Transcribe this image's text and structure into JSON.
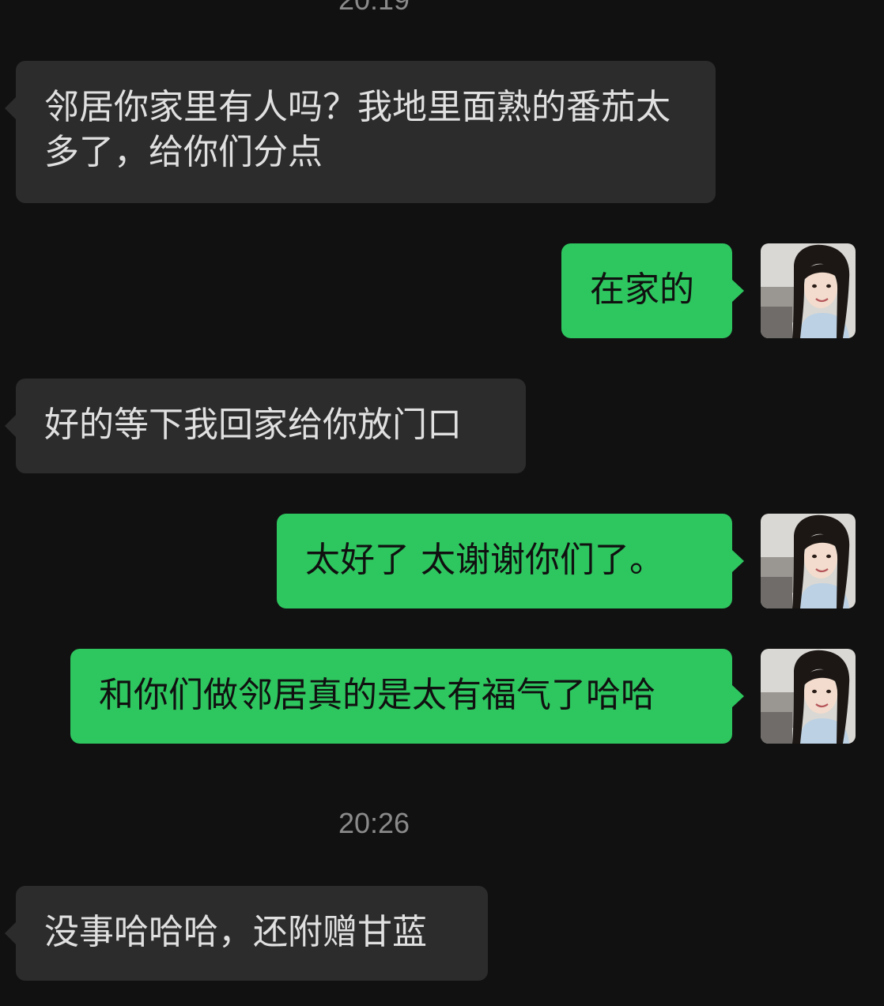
{
  "timestamps": {
    "top_partial": "20:19",
    "second": "20:26"
  },
  "messages": [
    {
      "side": "received",
      "text": "邻居你家里有人吗？我地里面熟的番茄太多了，给你们分点"
    },
    {
      "side": "sent",
      "text": "在家的"
    },
    {
      "side": "received",
      "text": "好的等下我回家给你放门口"
    },
    {
      "side": "sent",
      "text": "太好了 太谢谢你们了。"
    },
    {
      "side": "sent",
      "text": "和你们做邻居真的是太有福气了哈哈"
    },
    {
      "side": "received",
      "text": "没事哈哈哈，还附赠甘蓝"
    }
  ],
  "colors": {
    "background": "#111111",
    "received_bubble": "#2c2c2c",
    "sent_bubble": "#2ec65f",
    "timestamp_text": "#8a8a8a"
  },
  "avatar": {
    "icon": "user-avatar-photo"
  }
}
